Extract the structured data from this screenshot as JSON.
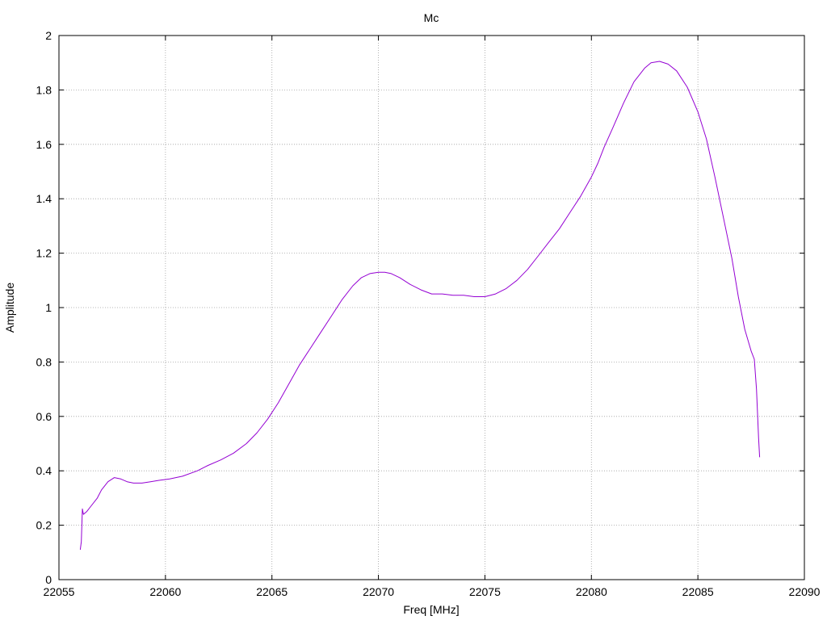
{
  "chart_data": {
    "type": "line",
    "title": "Mc",
    "xlabel": "Freq [MHz]",
    "ylabel": "Amplitude",
    "xlim": [
      22055,
      22090
    ],
    "ylim": [
      0,
      2
    ],
    "xticks": [
      22055,
      22060,
      22065,
      22070,
      22075,
      22080,
      22085,
      22090
    ],
    "yticks": [
      0,
      0.2,
      0.4,
      0.6,
      0.8,
      1,
      1.2,
      1.4,
      1.6,
      1.8,
      2
    ],
    "xtick_labels": [
      "22055",
      "22060",
      "22065",
      "22070",
      "22075",
      "22080",
      "22085",
      "22090"
    ],
    "ytick_labels": [
      "0",
      "0.2",
      "0.4",
      "0.6",
      "0.8",
      "1",
      "1.2",
      "1.4",
      "1.6",
      "1.8",
      "2"
    ],
    "grid": true,
    "series": [
      {
        "color": "#9400d3",
        "x": [
          22056.0,
          22056.05,
          22056.1,
          22056.15,
          22056.3,
          22056.5,
          22056.8,
          22057.0,
          22057.3,
          22057.6,
          22057.9,
          22058.2,
          22058.5,
          22058.9,
          22059.3,
          22059.7,
          22060.2,
          22060.8,
          22061.5,
          22062.0,
          22062.6,
          22063.2,
          22063.8,
          22064.3,
          22064.8,
          22065.3,
          22065.8,
          22066.3,
          22066.8,
          22067.3,
          22067.8,
          22068.3,
          22068.8,
          22069.2,
          22069.6,
          22070.0,
          22070.3,
          22070.6,
          22071.0,
          22071.5,
          22072.0,
          22072.5,
          22073.0,
          22073.5,
          22074.0,
          22074.5,
          22075.0,
          22075.5,
          22076.0,
          22076.5,
          22077.0,
          22077.5,
          22078.0,
          22078.5,
          22079.0,
          22079.5,
          22080.0,
          22080.3,
          22080.6,
          22081.0,
          22081.5,
          22082.0,
          22082.5,
          22082.8,
          22083.2,
          22083.6,
          22084.0,
          22084.5,
          22085.0,
          22085.4,
          22085.8,
          22086.2,
          22086.6,
          22086.9,
          22087.2,
          22087.5,
          22087.65,
          22087.75,
          22087.85,
          22087.9
        ],
        "y": [
          0.11,
          0.14,
          0.26,
          0.24,
          0.25,
          0.27,
          0.3,
          0.33,
          0.36,
          0.375,
          0.37,
          0.36,
          0.355,
          0.355,
          0.36,
          0.365,
          0.37,
          0.38,
          0.4,
          0.42,
          0.44,
          0.465,
          0.5,
          0.54,
          0.59,
          0.65,
          0.72,
          0.79,
          0.85,
          0.91,
          0.97,
          1.03,
          1.08,
          1.11,
          1.125,
          1.13,
          1.13,
          1.125,
          1.11,
          1.085,
          1.065,
          1.05,
          1.05,
          1.045,
          1.045,
          1.04,
          1.04,
          1.05,
          1.07,
          1.1,
          1.14,
          1.19,
          1.24,
          1.29,
          1.35,
          1.41,
          1.48,
          1.53,
          1.59,
          1.66,
          1.75,
          1.83,
          1.88,
          1.9,
          1.905,
          1.895,
          1.87,
          1.81,
          1.72,
          1.62,
          1.48,
          1.33,
          1.18,
          1.04,
          0.92,
          0.84,
          0.81,
          0.7,
          0.52,
          0.45
        ]
      }
    ]
  }
}
